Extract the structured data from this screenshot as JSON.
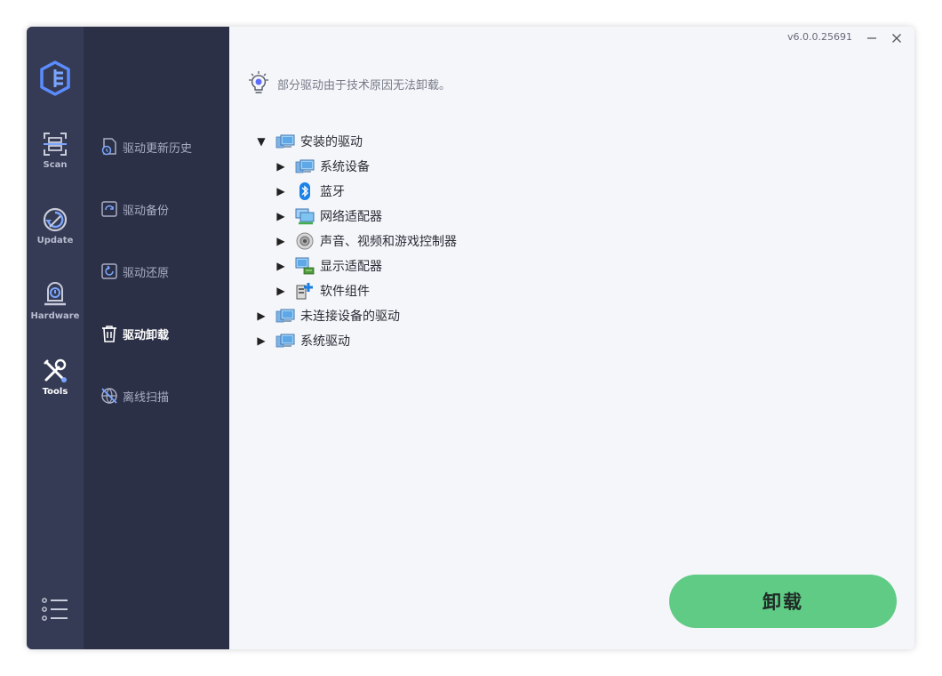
{
  "window": {
    "version": "v6.0.0.25691"
  },
  "rail": {
    "items": [
      {
        "label": "Scan"
      },
      {
        "label": "Update"
      },
      {
        "label": "Hardware"
      },
      {
        "label": "Tools"
      }
    ]
  },
  "submenu": {
    "items": [
      {
        "label": "驱动更新历史"
      },
      {
        "label": "驱动备份"
      },
      {
        "label": "驱动还原"
      },
      {
        "label": "驱动卸载"
      },
      {
        "label": "离线扫描"
      }
    ]
  },
  "main": {
    "notice": "部分驱动由于技术原因无法卸载。",
    "tree": [
      {
        "label": "安装的驱动",
        "expanded": true,
        "children": [
          {
            "label": "系统设备"
          },
          {
            "label": "蓝牙"
          },
          {
            "label": "网络适配器"
          },
          {
            "label": "声音、视频和游戏控制器"
          },
          {
            "label": "显示适配器"
          },
          {
            "label": "软件组件"
          }
        ]
      },
      {
        "label": "未连接设备的驱动",
        "expanded": false
      },
      {
        "label": "系统驱动",
        "expanded": false
      }
    ],
    "arrows": {
      "expanded": "▼",
      "collapsed": "▶"
    },
    "uninstall_label": "卸载"
  },
  "colors": {
    "accent_green": "#5fcb85",
    "rail_bg": "#363b55",
    "submenu_bg": "#2b3046",
    "main_bg": "#f5f6fa"
  }
}
